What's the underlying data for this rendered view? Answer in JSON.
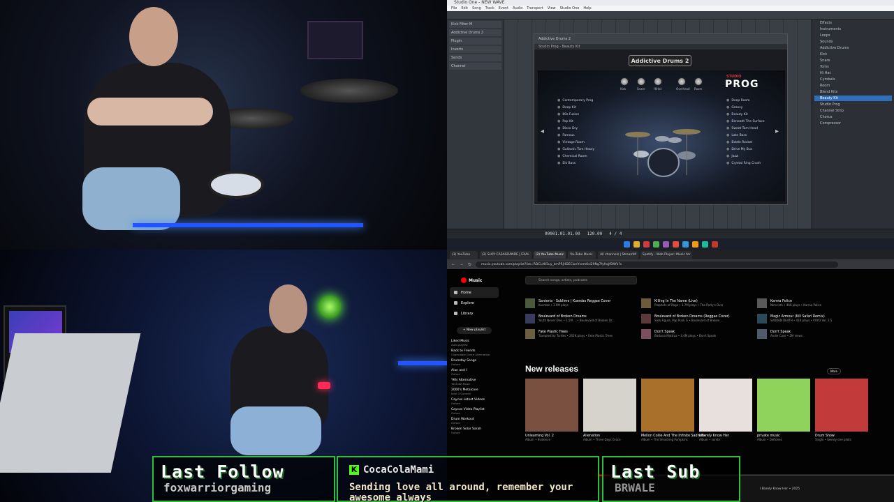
{
  "daw": {
    "window_title": "Studio One - NEW WAVE",
    "menu": [
      "File",
      "Edit",
      "Song",
      "Track",
      "Event",
      "Audio",
      "Transport",
      "View",
      "Studio One",
      "Help"
    ],
    "inspector": [
      "Kick Filter M",
      "Addictive Drums 2",
      "Plugin",
      "Inserts",
      "Sends",
      "Channel"
    ],
    "plugin": {
      "name": "Addictive Drums 2",
      "preset": "Studio Prog - Beauty Kit",
      "brand_sub": "STUDIO",
      "brand": "PROG",
      "knobs": [
        "Kick",
        "Snare",
        "HiHat",
        "Overhead",
        "Room"
      ],
      "left_list": [
        "Contemporary Prog",
        "Deep Kit",
        "80s Fusion",
        "Pop Kit",
        "Disco Dry",
        "Famous",
        "Vintage Room",
        "Gallactic Tom Heavy",
        "Chemical Room",
        "Elk Bass"
      ],
      "right_list": [
        "Deep Room",
        "Groovy",
        "Beauty Kit",
        "Beneath The Surface",
        "Sweet Tom Head",
        "Late Bass",
        "Bottle Rocket",
        "Drive My Bus",
        "Jazzi",
        "Crystal Ring Crush"
      ]
    },
    "browser_items": [
      "Effects",
      "Instruments",
      "Loops",
      "Sounds",
      "Addictive Drums",
      "Kick",
      "Snare",
      "Toms",
      "Hi Hat",
      "Cymbals",
      "Room",
      "Blend Kits",
      "Studio Prog",
      "Channel Strip",
      "Chorus",
      "Compressor"
    ],
    "selected_browser_item": "Beauty Kit",
    "transport": {
      "time": "00001.01.01.00",
      "bpm": "120.00",
      "sig": "4 / 4"
    }
  },
  "browser": {
    "tabs": [
      "(3) YouTube",
      "(2) SLOY CASAGRANDE | EXAL",
      "(2) YouTube Music",
      "YouTube Music",
      "All channels | StreamM",
      "Spotify - Web Player: Music for"
    ],
    "active_tab_index": 2,
    "url": "music.youtube.com/playlist?list=RDCLAK5uy_kmPRjHDECiovVvemKsi29Ng7fyHqjf0Wfk?s"
  },
  "ytm": {
    "logo": "Music",
    "search_placeholder": "Search songs, artists, podcasts",
    "nav": [
      "Home",
      "Explore",
      "Library"
    ],
    "new_playlist": "+ New playlist",
    "playlists": [
      {
        "title": "Liked Music",
        "sub": "Auto playlist"
      },
      {
        "title": "Back to Friends",
        "sub": "Charmable Grace Alternative"
      },
      {
        "title": "Drumday Songs",
        "sub": "Oxford"
      },
      {
        "title": "Aion and I",
        "sub": "Oxford"
      },
      {
        "title": "'90s Alternative",
        "sub": "YouTube Music"
      },
      {
        "title": "2000's Metalcore",
        "sub": "John O'Connell"
      },
      {
        "title": "Caycus Latest Videos",
        "sub": "Oxford"
      },
      {
        "title": "Caycus Video Playlist",
        "sub": "Oxford"
      },
      {
        "title": "Drum Workout",
        "sub": "Oxford"
      },
      {
        "title": "Broken Solar Sarah",
        "sub": "Oxford"
      }
    ],
    "songs": [
      {
        "title": "Santeria - Sublime | Kuerdas Reggae Cover",
        "sub": "Kuerdas • 3.9M plays"
      },
      {
        "title": "Killing In The Name (Live)",
        "sub": "Prophets of Rage • 1.7M plays • The Party's Over"
      },
      {
        "title": "Karma Police",
        "sub": "Nimi Info • 46K plays • Karma Police"
      },
      {
        "title": "Boulevard of Broken Dreams",
        "sub": "Youth Never Dies • 1.5M ... • Boulevard of Broken Dr..."
      },
      {
        "title": "Boulevard of Broken Dreams (Reggae Cover)",
        "sub": "Slick Figure, Pop Punk G • Boulevard of Broken ..."
      },
      {
        "title": "Magic Armour (Kill Safari Remix)",
        "sub": "SVDDEN DEATH • 41K plays • VOYD Vol. 2.5"
      },
      {
        "title": "Fake Plastic Trees",
        "sub": "Trampled by Turtles • 202K plays • Fake Plastic Trees"
      },
      {
        "title": "Don't Speak",
        "sub": "Barbara Mattraz • 4.4M plays • Don't Speak"
      },
      {
        "title": "Don't Speak",
        "sub": "Andie Case • 2M views"
      }
    ],
    "new_releases_title": "New releases",
    "more_label": "More",
    "albums": [
      {
        "title": "Unlearning Vol. 2",
        "sub": "Album • Evidence",
        "color": "#7a5040"
      },
      {
        "title": "Alienation",
        "sub": "Album • Three Days Grace",
        "color": "#d6d2cc"
      },
      {
        "title": "Mellon Collie And The Infinite Sadness",
        "sub": "Album • The Smashing Pumpkins",
        "color": "#a8702a"
      },
      {
        "title": "I Barely Know Her",
        "sub": "Album • sombr",
        "color": "#e8e0dc"
      },
      {
        "title": "private music",
        "sub": "Album • Deftones",
        "color": "#8fd25c"
      },
      {
        "title": "Drum Show",
        "sub": "Single • twenty one pilots",
        "color": "#c23a3a"
      }
    ],
    "now_playing": "I Barely Know Her • 2025",
    "progress": 0.03
  },
  "overlay": {
    "last_follow_label": "Last Follow",
    "last_follower": "foxwarriorgaming",
    "chat_user": "CocaColaMami",
    "chat_message": "Sending love all around, remember your awesome always",
    "last_sub_label": "Last Sub",
    "last_sub_name": "BRWALE"
  },
  "colors": {
    "accent_green": "#2fbf3a",
    "ytm_red": "#ff0000",
    "kick_green": "#53fc18"
  }
}
